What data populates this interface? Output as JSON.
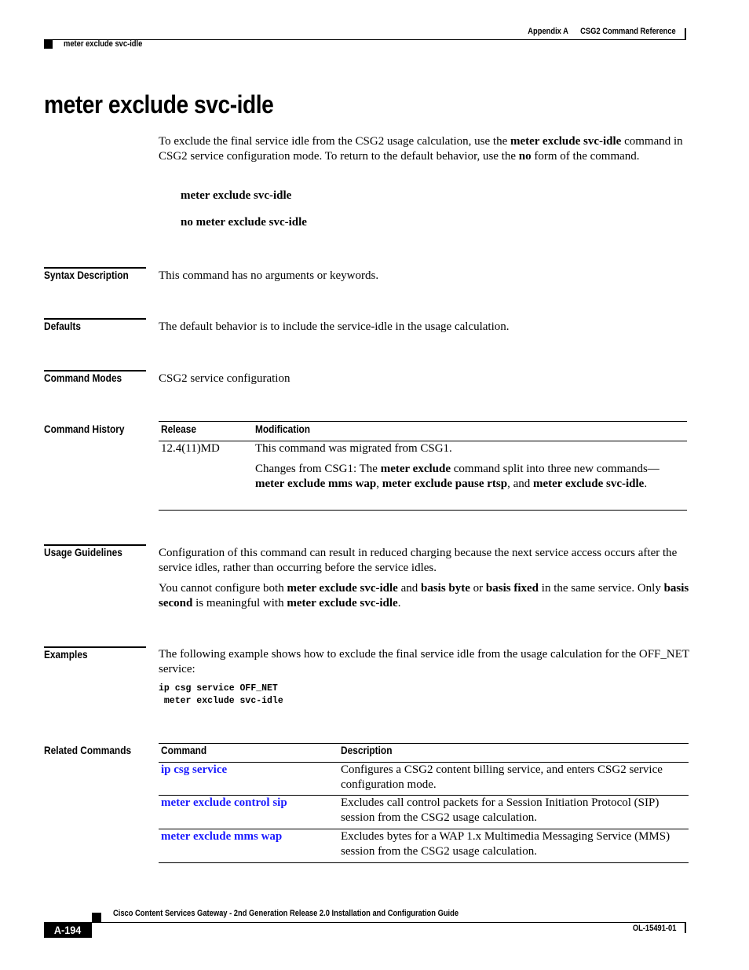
{
  "header": {
    "appendix": "Appendix A",
    "chapter": "CSG2 Command Reference",
    "running_title": "meter exclude svc-idle"
  },
  "title": "meter exclude svc-idle",
  "intro": {
    "t1": "To exclude the final service idle from the CSG2 usage calculation, use the ",
    "b1": "meter exclude svc-idle",
    "t2": " command in CSG2 service configuration mode. To return to the default behavior, use the ",
    "b2": "no",
    "t3": " form of the command."
  },
  "syntax": {
    "command": "meter exclude svc-idle",
    "no_command": "no meter exclude svc-idle"
  },
  "sections": {
    "syntax_description": {
      "label": "Syntax Description",
      "text": "This command has no arguments or keywords."
    },
    "defaults": {
      "label": "Defaults",
      "text": "The default behavior is to include the service-idle in the usage calculation."
    },
    "command_modes": {
      "label": "Command Modes",
      "text": "CSG2 service configuration"
    },
    "command_history": {
      "label": "Command History",
      "columns": [
        "Release",
        "Modification"
      ],
      "rows": [
        {
          "release": "12.4(11)MD",
          "mod1": "This command was migrated from CSG1.",
          "mod2": {
            "t1": "Changes from CSG1: The ",
            "b1": "meter exclude",
            "t2": " command split into three new commands—",
            "b2": "meter exclude mms wap",
            "t3": ", ",
            "b3": "meter exclude pause rtsp",
            "t4": ", and ",
            "b4": "meter exclude svc-idle",
            "t5": "."
          }
        }
      ]
    },
    "usage_guidelines": {
      "label": "Usage Guidelines",
      "p1": "Configuration of this command can result in reduced charging because the next service access occurs after the service idles, rather than occurring before the service idles.",
      "p2": {
        "t1": "You cannot configure both ",
        "b1": "meter exclude svc-idle",
        "t2": " and ",
        "b2": "basis byte",
        "t3": " or ",
        "b3": "basis fixed",
        "t4": " in the same service. Only ",
        "b4": "basis second",
        "t5": " is meaningful with ",
        "b5": "meter exclude svc-idle",
        "t6": "."
      }
    },
    "examples": {
      "label": "Examples",
      "text": "The following example shows how to exclude the final service idle from the usage calculation for the OFF_NET service:",
      "code_line1": "ip csg service OFF_NET",
      "code_line2": " meter exclude svc-idle"
    },
    "related_commands": {
      "label": "Related Commands",
      "columns": [
        "Command",
        "Description"
      ],
      "rows": [
        {
          "command": "ip csg service",
          "description": "Configures a CSG2 content billing service, and enters CSG2 service configuration mode."
        },
        {
          "command": "meter exclude control sip",
          "description": "Excludes call control packets for a Session Initiation Protocol (SIP) session from the CSG2 usage calculation."
        },
        {
          "command": "meter exclude mms wap",
          "description": "Excludes bytes for a WAP 1.x Multimedia Messaging Service (MMS) session from the CSG2 usage calculation."
        }
      ]
    }
  },
  "footer": {
    "guide_title": "Cisco Content Services Gateway - 2nd Generation Release 2.0 Installation and Configuration Guide",
    "page_number": "A-194",
    "doc_number": "OL-15491-01"
  },
  "colors": {
    "link": "#1a1aff",
    "text": "#000000"
  }
}
